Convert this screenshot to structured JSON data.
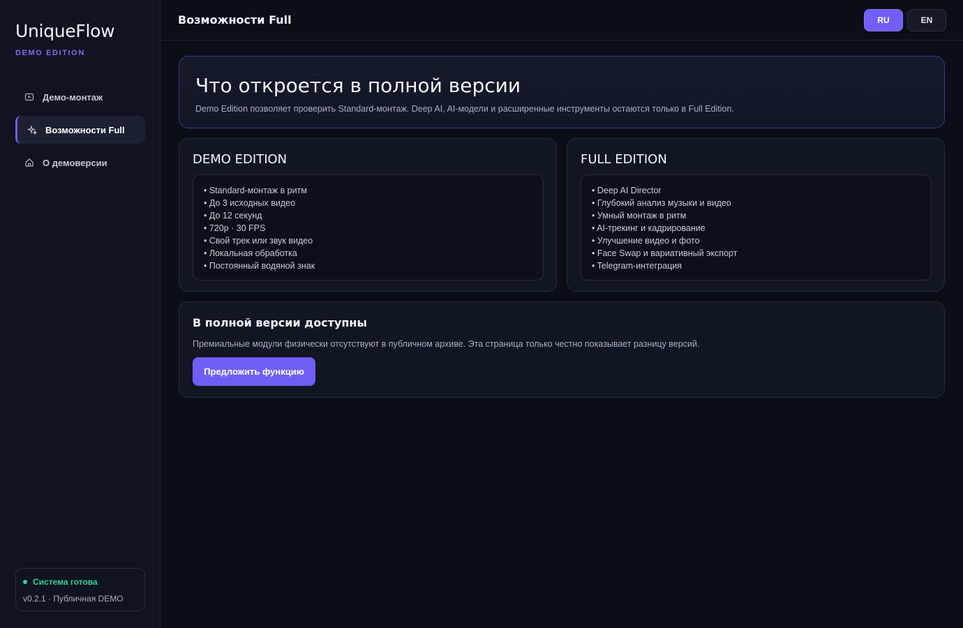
{
  "sidebar": {
    "brand_title": "UniqueFlow",
    "brand_sub": "DEMO EDITION",
    "items": [
      {
        "label": "Демо-монтаж",
        "icon": "video-icon",
        "active": false
      },
      {
        "label": "Возможности Full",
        "icon": "sparkles-icon",
        "active": true
      },
      {
        "label": "О демоверсии",
        "icon": "home-icon",
        "active": false
      }
    ],
    "status": {
      "text": "Система готова",
      "version": "v0.2.1 · Публичная DEMO",
      "color": "#34d399"
    }
  },
  "header": {
    "title": "Возможности Full",
    "lang_ru": "RU",
    "lang_en": "EN",
    "active_lang": "RU"
  },
  "hero": {
    "title": "Что откроется в полной версии",
    "description": "Demo Edition позволяет проверить Standard-монтаж. Deep AI, AI-модели и расширенные инструменты остаются только в Full Edition."
  },
  "demo_card": {
    "title": "DEMO EDITION",
    "features": [
      "• Standard-монтаж в ритм",
      "• До 3 исходных видео",
      "• До 12 секунд",
      "• 720p · 30 FPS",
      "• Свой трек или звук видео",
      "• Локальная обработка",
      "• Постоянный водяной знак"
    ]
  },
  "full_card": {
    "title": "FULL EDITION",
    "features": [
      "• Deep AI Director",
      "• Глубокий анализ музыки и видео",
      "• Умный монтаж в ритм",
      "• AI-трекинг и кадрирование",
      "• Улучшение видео и фото",
      "• Face Swap и вариативный экспорт",
      "• Telegram-интеграция"
    ]
  },
  "cta": {
    "title": "В полной версии доступны",
    "description": "Премиальные модули физически отсутствуют в публичном архиве. Эта страница только честно показывает разницу версий.",
    "button_label": "Предложить функцию"
  },
  "colors": {
    "accent": "#6f5ff5",
    "background": "#0b0e17",
    "success": "#34d399"
  }
}
